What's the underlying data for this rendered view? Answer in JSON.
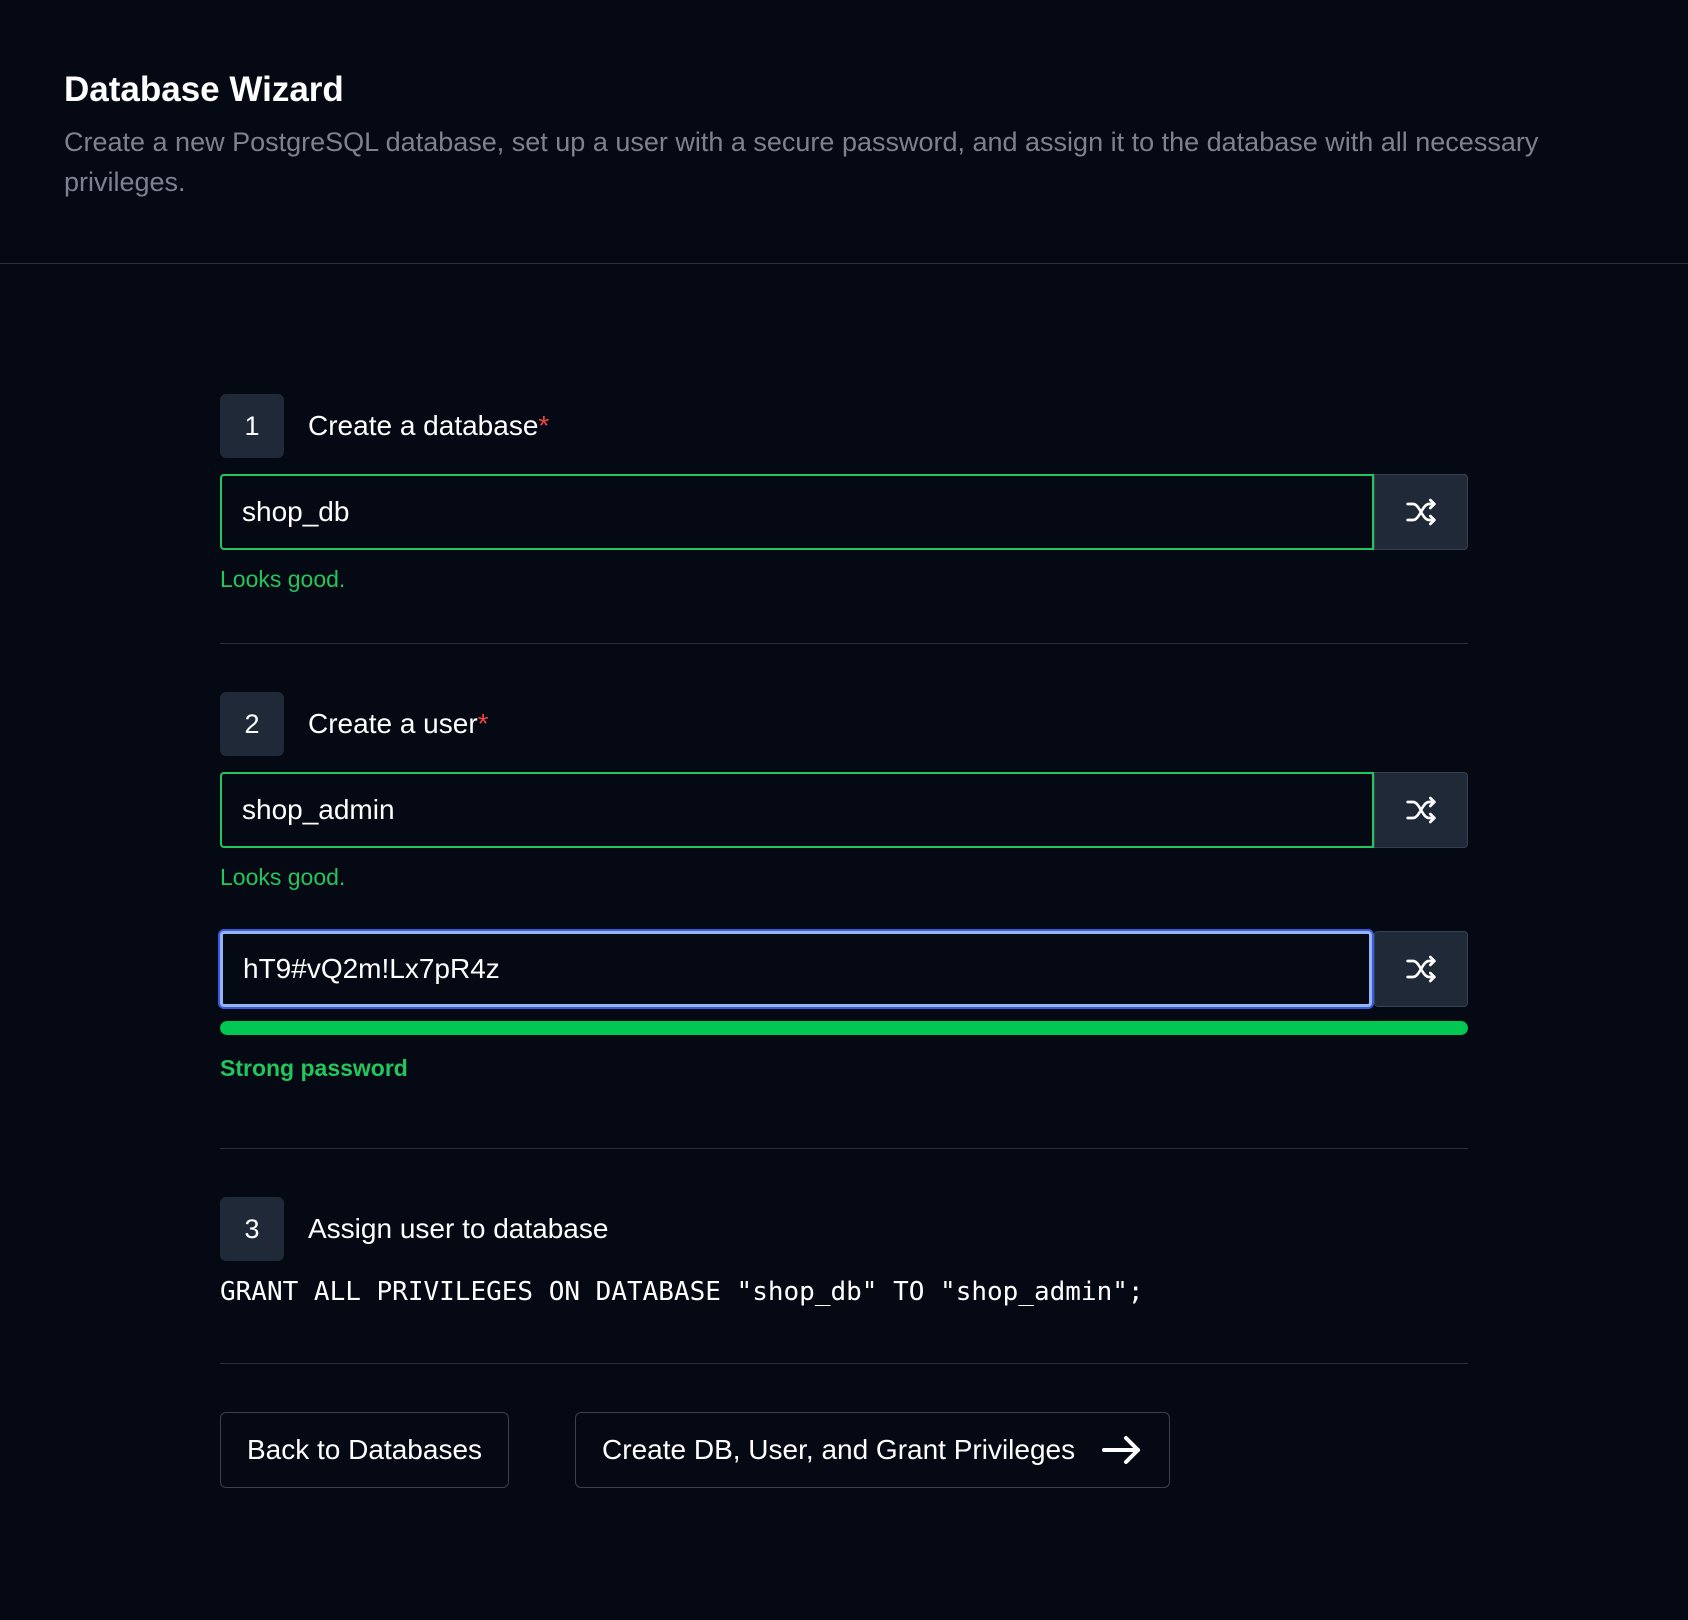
{
  "header": {
    "title": "Database Wizard",
    "description": "Create a new PostgreSQL database, set up a user with a secure password, and assign it to the database with all necessary privileges."
  },
  "steps": [
    {
      "number": "1",
      "label": "Create a database",
      "required_mark": "*",
      "input_value": "shop_db",
      "feedback": "Looks good."
    },
    {
      "number": "2",
      "label": "Create a user",
      "required_mark": "*",
      "input_value": "shop_admin",
      "feedback": "Looks good.",
      "password_value": "hT9#vQ2m!Lx7pR4z",
      "password_strength": 1.0,
      "password_strength_label": "Strong password"
    },
    {
      "number": "3",
      "label": "Assign user to database",
      "sql": "GRANT ALL PRIVILEGES ON DATABASE \"shop_db\" TO \"shop_admin\";"
    }
  ],
  "actions": {
    "back_label": "Back to Databases",
    "submit_label": "Create DB, User, and Grant Privileges"
  },
  "icons": {
    "shuffle": "shuffle-icon",
    "arrow": "arrow-right-icon"
  },
  "colors": {
    "background": "#050913",
    "success": "#22c55e",
    "strength_fill": "#00c853",
    "required": "#ef4444",
    "focus_border": "#93b4f5"
  }
}
